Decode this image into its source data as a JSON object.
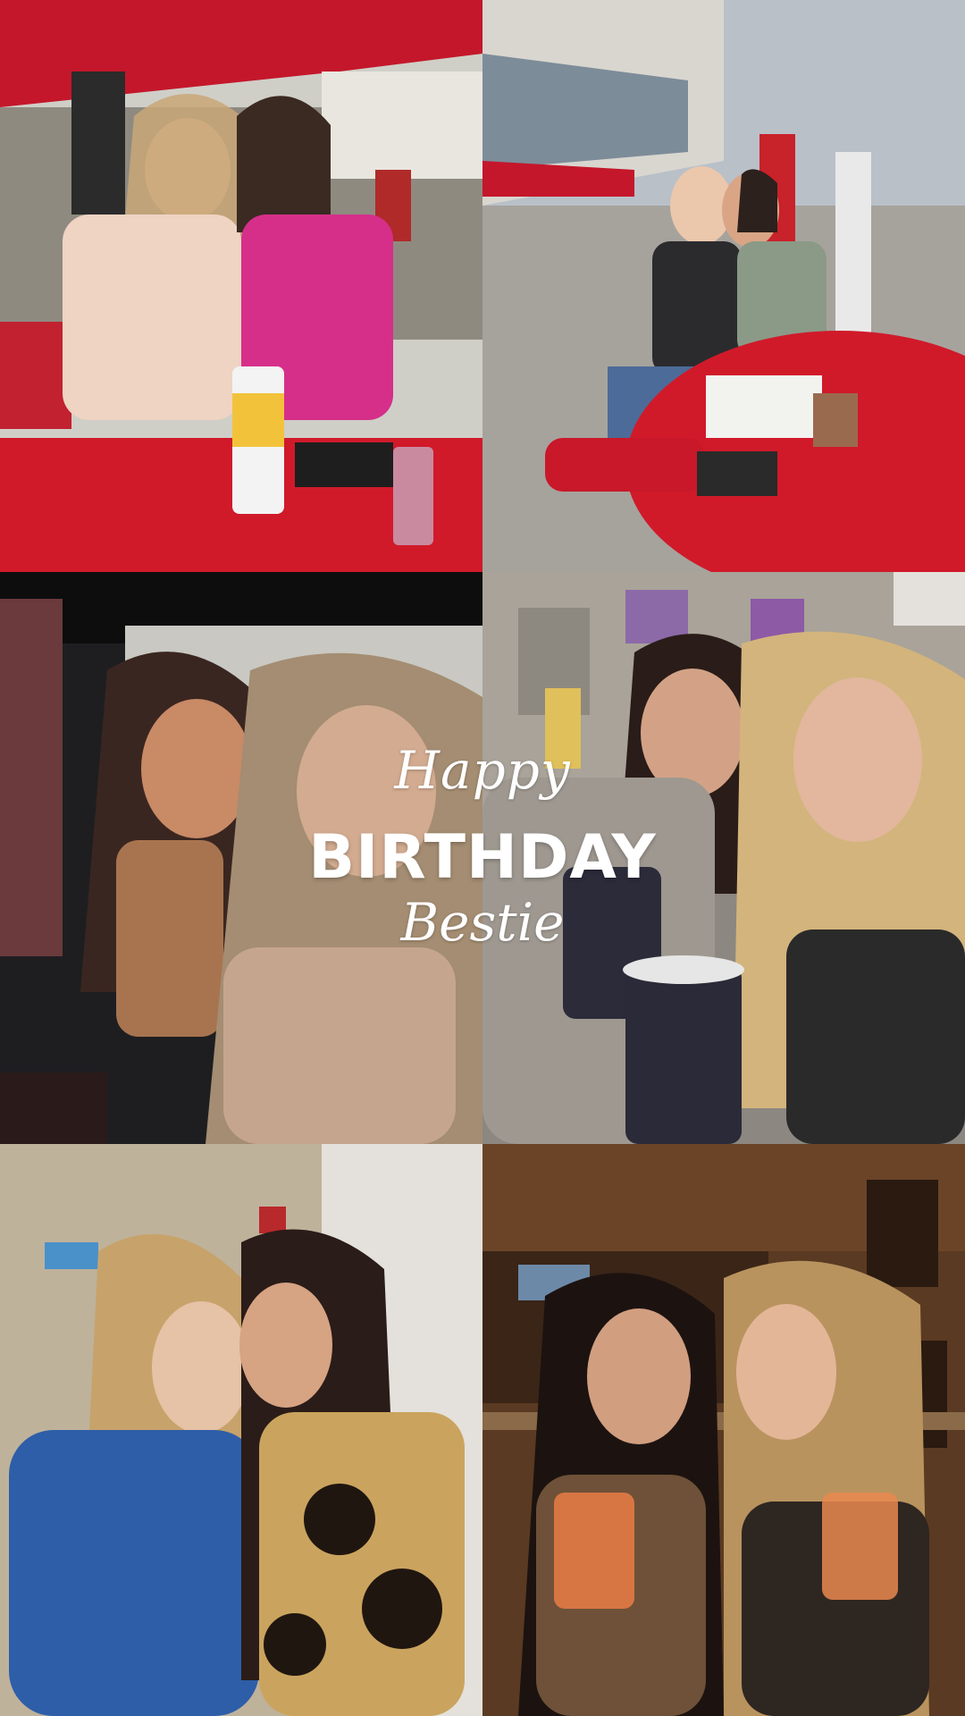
{
  "overlay": {
    "line1": "Happy",
    "line2": "BIRTHDAY",
    "line3": "Bestie"
  },
  "photos": [
    {
      "scene": "two women at red mesh table under red canopy"
    },
    {
      "scene": "two women seated at red table at racetrack grandstand"
    },
    {
      "scene": "two women selfie inside vehicle"
    },
    {
      "scene": "two women with drinks in front of mural"
    },
    {
      "scene": "two women in barn, blue hoodie and bleached top"
    },
    {
      "scene": "two women with cocktails in wood-paneled bar"
    }
  ],
  "colors": {
    "canopy_red": "#c4172b",
    "table_red": "#d01a2a",
    "text_white": "#ffffff"
  }
}
